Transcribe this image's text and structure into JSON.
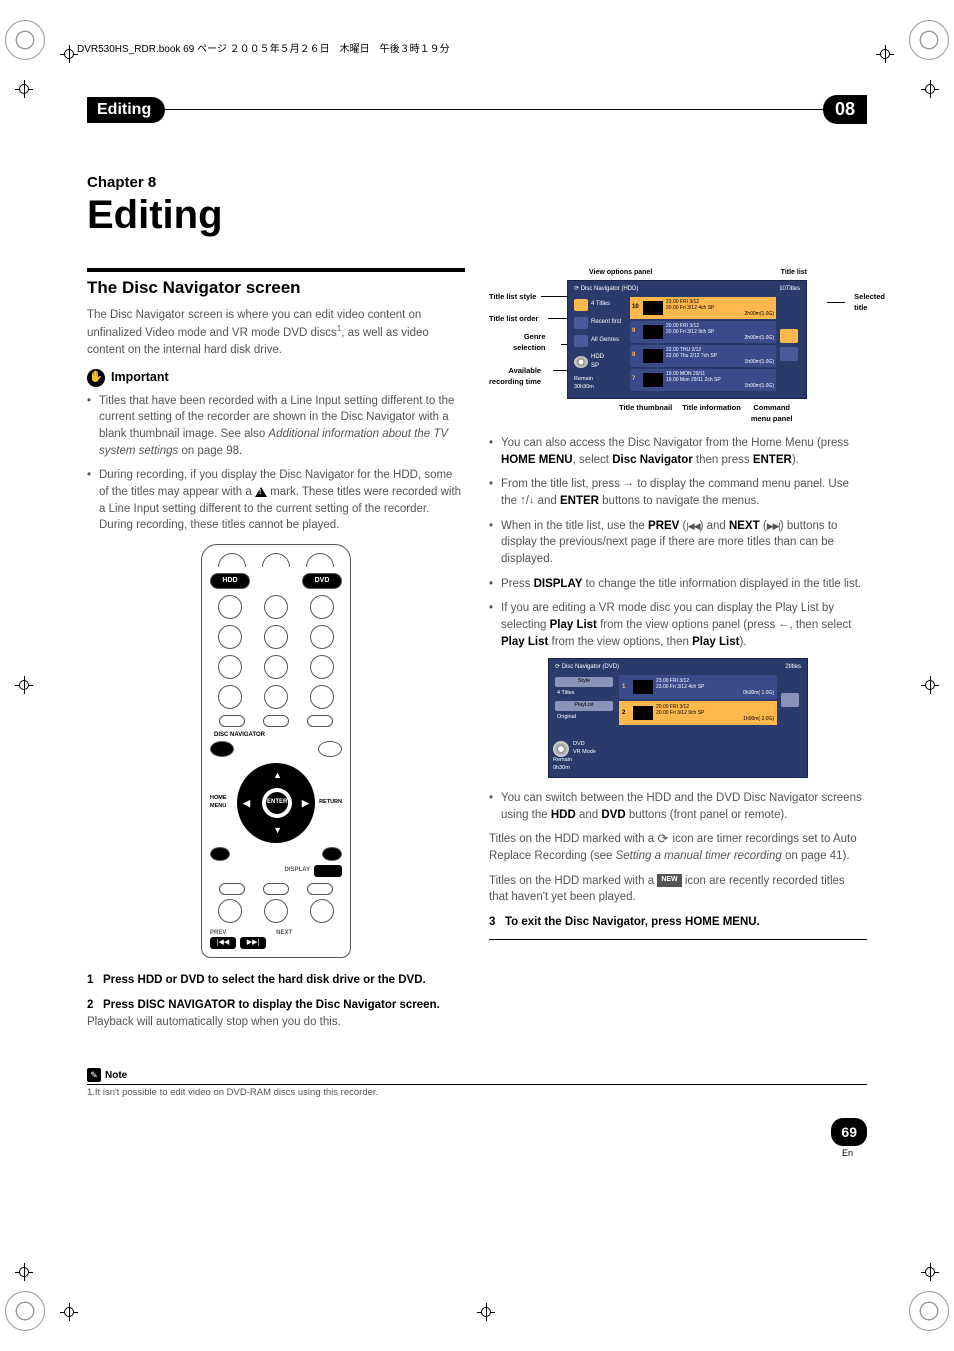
{
  "book_header": "DVR530HS_RDR.book  69 ページ  ２００５年５月２６日　木曜日　午後３時１９分",
  "top_bar": {
    "left": "Editing",
    "right": "08"
  },
  "chapter": {
    "label": "Chapter 8",
    "title": "Editing"
  },
  "left": {
    "section_title": "The Disc Navigator screen",
    "intro_a": "The Disc Navigator screen is where you can edit video content on unfinalized Video mode and VR mode DVD discs",
    "intro_b": ", as well as video content on the internal hard disk drive.",
    "sup": "1",
    "important_label": "Important",
    "b1": "Titles that have been recorded with a Line Input setting different to the current setting of the recorder are shown in the Disc Navigator with a blank thumbnail image. See also ",
    "b1_i": "Additional information about the TV system settings",
    "b1_c": " on page 98.",
    "b2a": "During recording, if you display the Disc Navigator for the HDD, some of the titles may appear with a ",
    "b2b": " mark. These titles were recorded with a Line Input setting different to the current setting of the recorder. During recording, these titles cannot be played.",
    "remote": {
      "hdd": "HDD",
      "dvd": "DVD",
      "disc_nav": "DISC NAVIGATOR",
      "enter": "ENTER",
      "home_menu": "HOME\nMENU",
      "return": "RETURN",
      "display": "DISPLAY",
      "prev": "PREV",
      "next": "NEXT",
      "prev_sym": "|◀◀",
      "next_sym": "▶▶|"
    },
    "step1_n": "1",
    "step1": "Press HDD or DVD to select the hard disk drive or the DVD.",
    "step2_n": "2",
    "step2": "Press DISC NAVIGATOR to display the Disc Navigator screen.",
    "step2_sub": "Playback will automatically stop when you do this."
  },
  "right": {
    "labels": {
      "view_options": "View options panel",
      "title_list": "Title list",
      "title_style": "Title list style",
      "title_order": "Title list order",
      "genre": "Genre\nselection",
      "available": "Available\nrecording time",
      "selected": "Selected\ntitle",
      "thumb": "Title thumbnail",
      "info": "Title information",
      "cmd": "Command\nmenu panel"
    },
    "nav": {
      "header": "Disc Navigator (HDD)",
      "count": "10Titles",
      "side_style": "4 Titles",
      "side_order": "Recent first",
      "side_genre": "All Genres",
      "side_media": "HDD\nSP",
      "side_remain": "Remain\n30h30m",
      "rows": [
        {
          "n": "10",
          "l1": "23.00 FRI  3/12",
          "l2": "20.00 Fri 3/12 4ch  SP",
          "r": "2h00m(1.0G)"
        },
        {
          "n": "9",
          "l1": "20.00 FRI  3/12",
          "l2": "20.00 Fri 3/12 9ch  SP",
          "r": "2h00m(1.0G)"
        },
        {
          "n": "8",
          "l1": "22.00 THU 2/12",
          "l2": "22.00 Thu 2/12 7ch  SP",
          "r": "1h00m(1.0G)"
        },
        {
          "n": "7",
          "l1": "19.00 MON  29/11",
          "l2": "19.00 Mon 29/11 2ch  SP",
          "r": "1h00m(1.0G)"
        }
      ]
    },
    "b1a": "You can also access the Disc Navigator from the Home Menu (press ",
    "b1b": "HOME MENU",
    "b1c": ", select ",
    "b1d": "Disc Navigator",
    "b1e": " then press ",
    "b1f": "ENTER",
    "b1g": ").",
    "b2a": "From the title list, press ",
    "b2arrow": "→",
    "b2b": " to display the command menu panel. Use the ",
    "b2up": "↑",
    "b2slash": "/",
    "b2down": "↓",
    "b2c": " and ",
    "b2d": "ENTER",
    "b2e": " buttons to navigate the menus.",
    "b3a": "When in the title list, use the ",
    "b3b": "PREV",
    "b3c": " (",
    "b3d": ") and ",
    "b3e": "NEXT",
    "b3f": " (",
    "b3g": ") buttons to display the previous/next page if there are more titles than can be displayed.",
    "b4a": "Press ",
    "b4b": "DISPLAY",
    "b4c": " to change the title information displayed in the title list.",
    "b5a": "If you are editing a VR mode disc you can display the Play List by selecting ",
    "b5b": "Play List",
    "b5c": "  from the view options panel (press ",
    "b5arrow": "←",
    "b5d": ", then select ",
    "b5e": "Play List",
    "b5f": " from the view options, then ",
    "b5g": "Play List",
    "b5h": ").",
    "dvd_nav": {
      "header": "Disc Navigator (DVD)",
      "count": "2titles",
      "style_btn": "Style",
      "style_txt": "4 Titles",
      "pl_btn": "PlayList",
      "pl_txt": "Original",
      "rows": [
        {
          "n": "1",
          "l1": "23.00 FRI  3/12",
          "l2": "23.00 Fri 3/12  4ch  SP",
          "r": "0h30m( 1.0G)"
        },
        {
          "n": "2",
          "l1": "20.00 FRI  3/12",
          "l2": "20.00 Fri 3/12  9ch  SP",
          "r": "1h00m( 2.0G)"
        }
      ],
      "mode": "DVD\nVR Mode",
      "remain": "Remain\n0h30m"
    },
    "b6a": "You can switch between the HDD and the DVD Disc Navigator screens using the ",
    "b6b": "HDD",
    "b6c": " and ",
    "b6d": "DVD",
    "b6e": " buttons (front panel or remote).",
    "p1a": "Titles on the HDD marked with a ",
    "p1b": " icon are timer recordings set to Auto Replace Recording (see ",
    "p1_i": "Setting a manual timer recording",
    "p1c": " on page 41).",
    "p2a": "Titles on the HDD marked with a ",
    "p2_badge": "NEW",
    "p2b": " icon are recently recorded titles that haven't yet been played.",
    "step3_n": "3",
    "step3": "To exit the Disc Navigator, press HOME MENU."
  },
  "note": {
    "label": "Note",
    "text": "1.It isn't possible to edit video on DVD-RAM discs using this recorder."
  },
  "page_number": "69",
  "page_lang": "En"
}
